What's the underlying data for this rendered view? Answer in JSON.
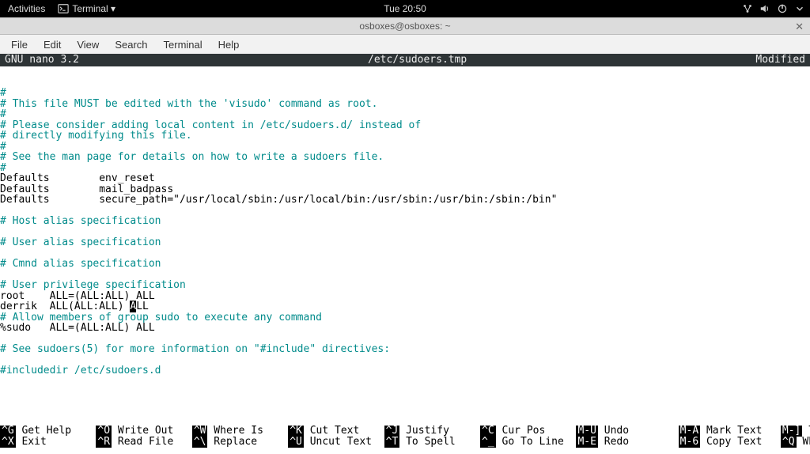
{
  "topbar": {
    "activities": "Activities",
    "terminal_app": "Terminal ▾",
    "clock": "Tue 20:50"
  },
  "window": {
    "title": "osboxes@osboxes: ~",
    "close": "✕"
  },
  "menubar": {
    "file": "File",
    "edit": "Edit",
    "view": "View",
    "search": "Search",
    "terminal": "Terminal",
    "help": "Help"
  },
  "nano": {
    "version": "  GNU nano 3.2",
    "file": "/etc/sudoers.tmp",
    "modified": "Modified  "
  },
  "content": {
    "l1": "#",
    "l2": "# This file MUST be edited with the 'visudo' command as root.",
    "l3": "#",
    "l4": "# Please consider adding local content in /etc/sudoers.d/ instead of",
    "l5": "# directly modifying this file.",
    "l6": "#",
    "l7": "# See the man page for details on how to write a sudoers file.",
    "l8": "#",
    "l9": "Defaults        env_reset",
    "l10": "Defaults        mail_badpass",
    "l11": "Defaults        secure_path=\"/usr/local/sbin:/usr/local/bin:/usr/sbin:/usr/bin:/sbin:/bin\"",
    "l12": "# Host alias specification",
    "l13": "# User alias specification",
    "l14": "# Cmnd alias specification",
    "l15": "# User privilege specification",
    "l16": "root    ALL=(ALL:ALL) ALL",
    "l17a": "derrik  ALL(ALL:ALL) ",
    "l17b": "A",
    "l17c": "LL",
    "l18": "# Allow members of group sudo to execute any command",
    "l19": "%sudo   ALL=(ALL:ALL) ALL",
    "l20": "# See sudoers(5) for more information on \"#include\" directives:",
    "l21": "#includedir /etc/sudoers.d"
  },
  "shortcuts": {
    "k1": "^G",
    "t1": " Get Help    ",
    "k2": "^O",
    "t2": " Write Out   ",
    "k3": "^W",
    "t3": " Where Is    ",
    "k4": "^K",
    "t4": " Cut Text    ",
    "k5": "^J",
    "t5": " Justify     ",
    "k6": "^C",
    "t6": " Cur Pos     ",
    "k7": "M-U",
    "t7": " Undo        ",
    "k8": "M-A",
    "t8": " Mark Text   ",
    "k9": "M-]",
    "t9": " To Bracket",
    "k10": "^X",
    "t10": " Exit        ",
    "k11": "^R",
    "t11": " Read File   ",
    "k12": "^\\",
    "t12": " Replace     ",
    "k13": "^U",
    "t13": " Uncut Text  ",
    "k14": "^T",
    "t14": " To Spell    ",
    "k15": "^_",
    "t15": " Go To Line  ",
    "k16": "M-E",
    "t16": " Redo        ",
    "k17": "M-6",
    "t17": " Copy Text   ",
    "k18": "^Q",
    "t18": " Where Was"
  }
}
